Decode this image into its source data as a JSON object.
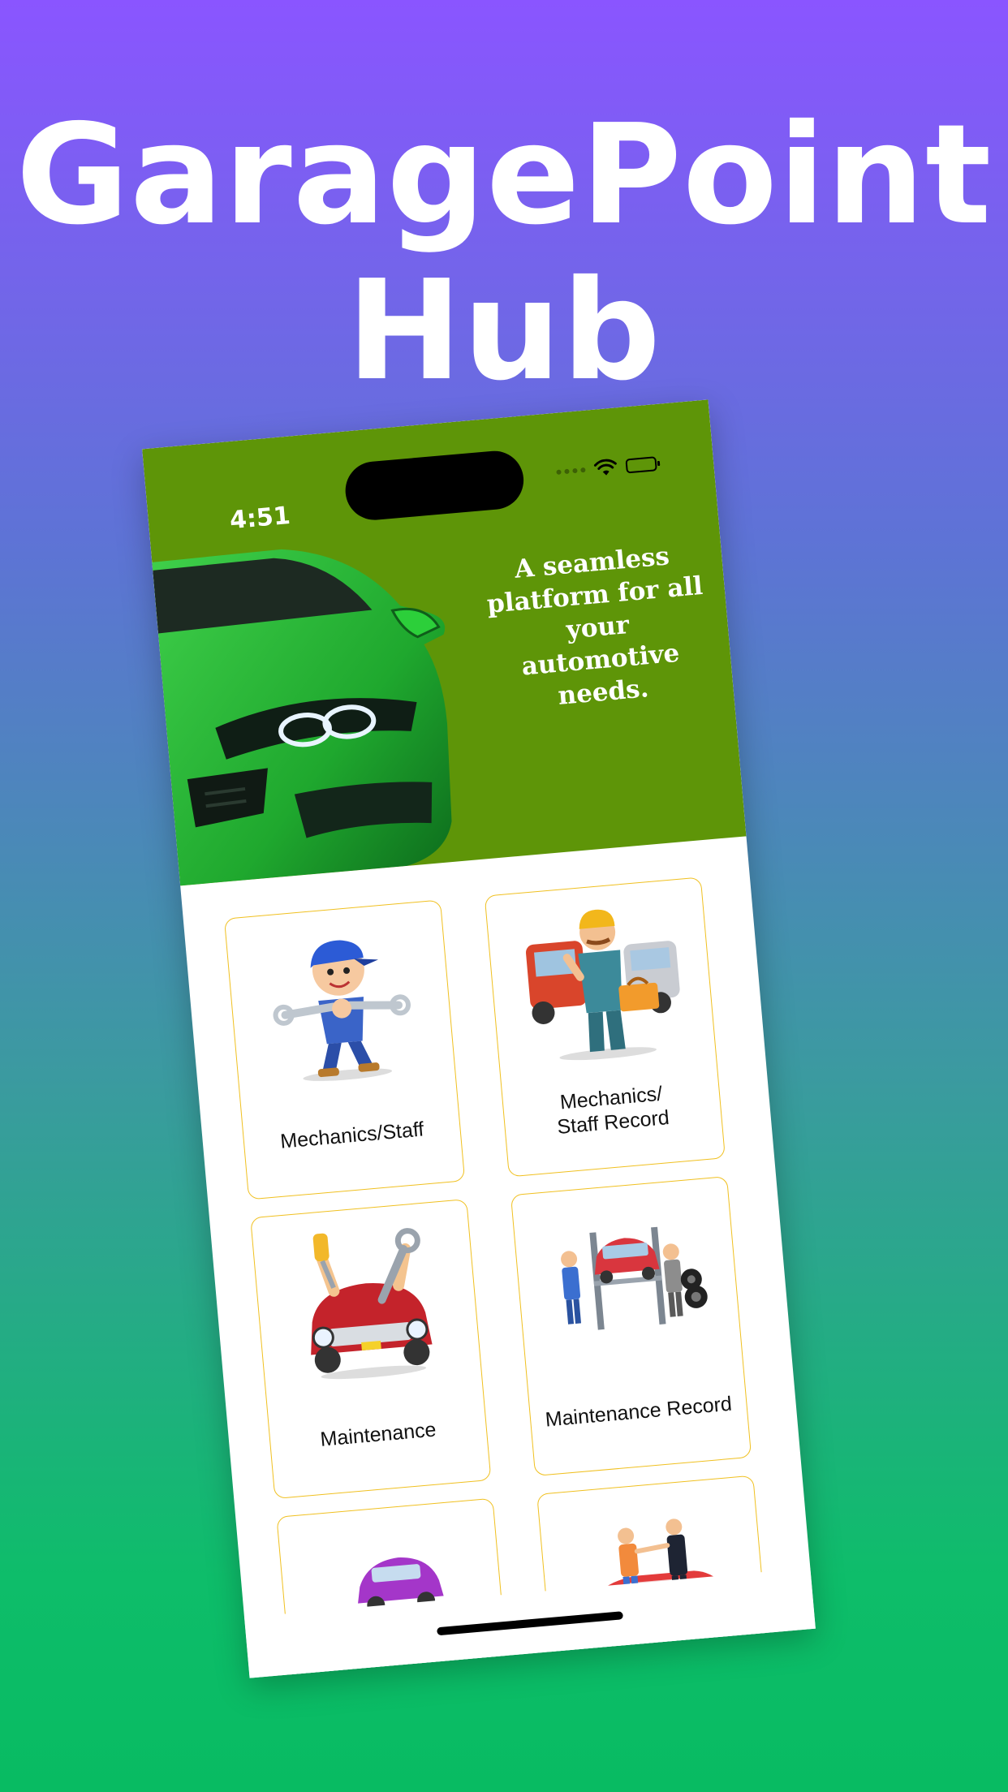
{
  "headline": {
    "line1": "GaragePoint",
    "line2": "Hub"
  },
  "status": {
    "time": "4:51",
    "wifi_icon": "wifi-icon",
    "battery_icon": "battery-icon"
  },
  "hero": {
    "tagline": "A seamless platform for all your automotive needs.",
    "image_icon": "green-sports-car"
  },
  "cards": [
    {
      "label": "Mechanics/Staff",
      "icon": "mechanic-boy-wrench"
    },
    {
      "label": "Mechanics/\nStaff Record",
      "icon": "mechanic-with-toolbox"
    },
    {
      "label": "Maintenance",
      "icon": "car-repair-tools"
    },
    {
      "label": "Maintenance Record",
      "icon": "car-lift-workshop"
    },
    {
      "label": "",
      "icon": "car-sale-money"
    },
    {
      "label": "",
      "icon": "car-deal-handshake"
    }
  ],
  "colors": {
    "hero_green": "#5e9508",
    "card_border": "#f0c020",
    "gradient_top": "#8a55ff",
    "gradient_bottom": "#08bb62"
  }
}
